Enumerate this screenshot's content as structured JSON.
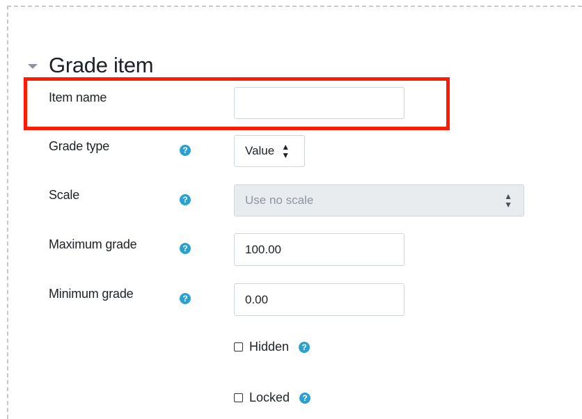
{
  "section": {
    "title": "Grade item"
  },
  "fields": {
    "item_name": {
      "label": "Item name",
      "value": ""
    },
    "grade_type": {
      "label": "Grade type",
      "value": "Value"
    },
    "scale": {
      "label": "Scale",
      "value": "Use no scale",
      "disabled": true
    },
    "maximum_grade": {
      "label": "Maximum grade",
      "value": "100.00"
    },
    "minimum_grade": {
      "label": "Minimum grade",
      "value": "0.00"
    },
    "hidden": {
      "label": "Hidden",
      "checked": false
    },
    "locked": {
      "label": "Locked",
      "checked": false
    }
  },
  "icons": {
    "help": "question-circle-icon",
    "collapse": "caret-down-icon",
    "select_arrows": "sort-updown-icon"
  },
  "colors": {
    "help_icon": "#2ba1cf",
    "highlight": "#ff1a00",
    "disabled_bg": "#e9ecef"
  }
}
